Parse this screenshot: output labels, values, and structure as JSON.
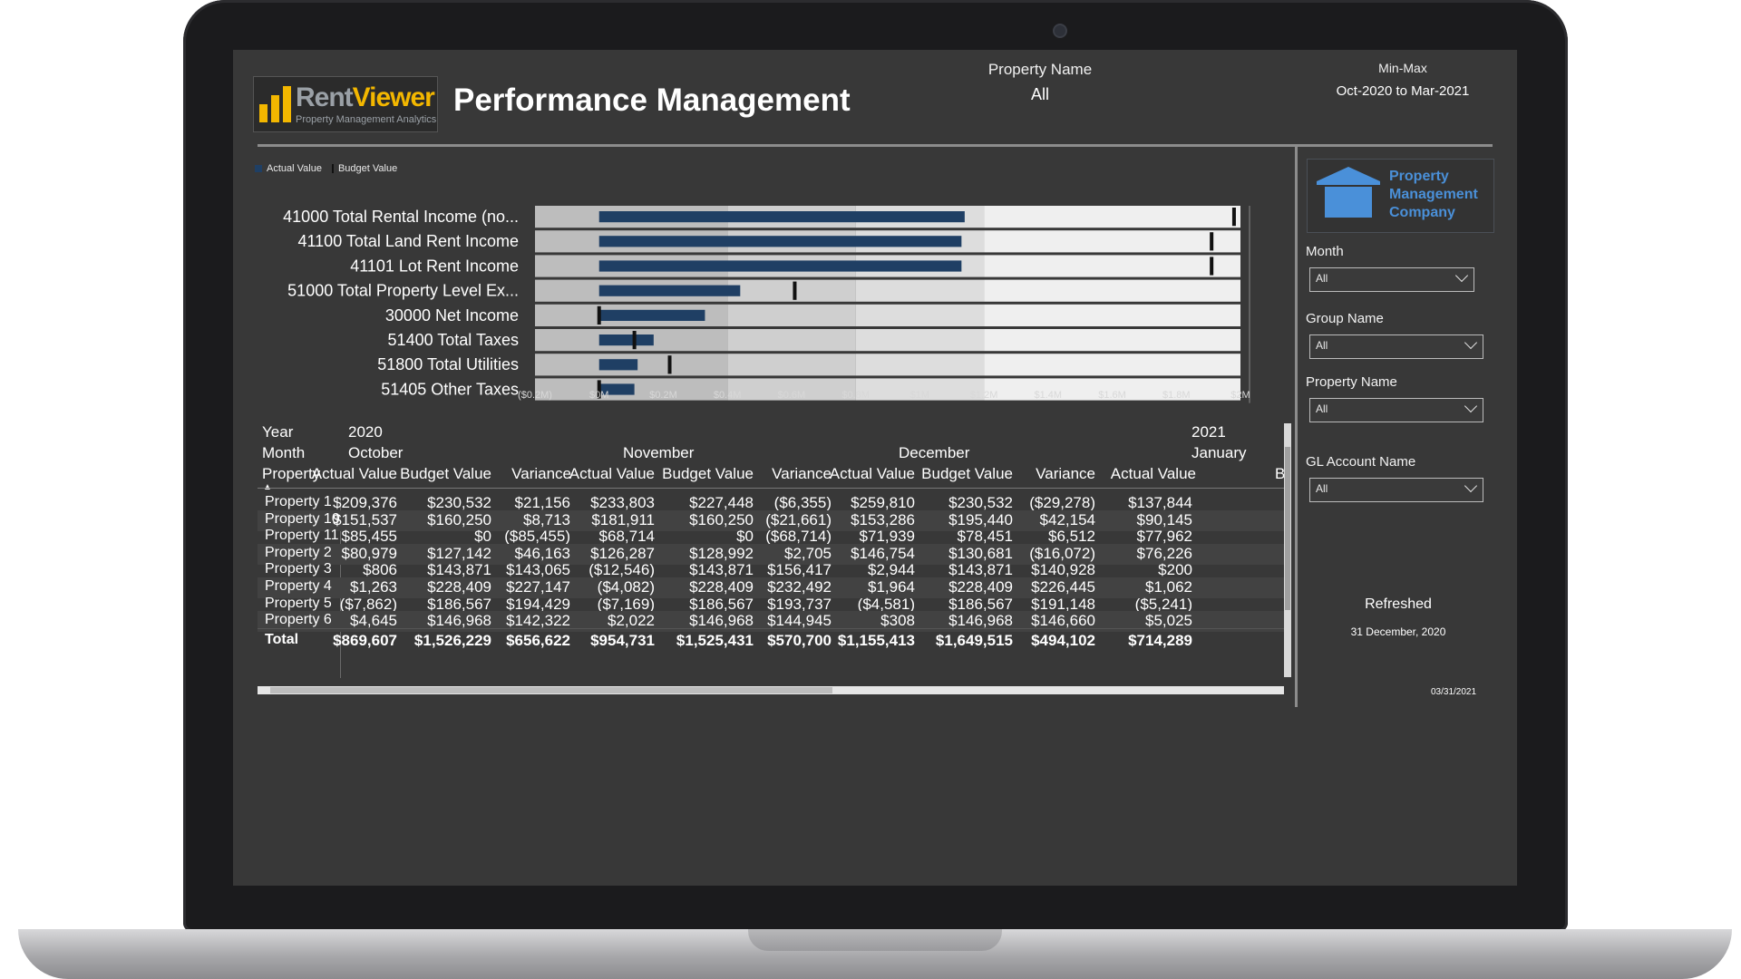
{
  "header": {
    "logo_word1": "Rent",
    "logo_word2": "Viewer",
    "logo_tagline": "Property Management Analytics",
    "title": "Performance Management",
    "property_label": "Property Name",
    "property_value": "All",
    "minmax_label": "Min-Max",
    "minmax_value": "Oct-2020 to Mar-2021"
  },
  "legend": {
    "actual": "Actual Value",
    "budget": "Budget Value"
  },
  "chart_data": {
    "type": "bar",
    "orientation": "horizontal",
    "subtype": "bullet",
    "categories": [
      "41000 Total Rental Income (no...",
      "41100 Total Land Rent Income",
      "41101 Lot Rent Income",
      "51000 Total Property Level Ex...",
      "30000 Net Income",
      "51400 Total Taxes",
      "51800 Total Utilities",
      "51405 Other Taxes"
    ],
    "series": [
      {
        "name": "Actual Value",
        "values": [
          1.14,
          1.13,
          1.13,
          0.44,
          0.33,
          0.17,
          0.12,
          0.11
        ]
      },
      {
        "name": "Budget Value",
        "values": [
          1.98,
          1.91,
          1.91,
          0.61,
          0.0,
          0.11,
          0.22,
          0.0
        ]
      }
    ],
    "xlim": [
      -0.2,
      2.0
    ],
    "xticks": [
      "($0.2M)",
      "$0M",
      "$0.2M",
      "$0.4M",
      "$0.6M",
      "$0.8M",
      "$1M",
      "$1.2M",
      "$1.4M",
      "$1.6M",
      "$1.8M",
      "$2M"
    ],
    "bands": [
      0.4,
      0.8,
      1.2,
      2.0
    ],
    "band_colors": [
      "#bdbdbd",
      "#cfcfcf",
      "#dddddd",
      "#efefef"
    ],
    "actual_color": "#1f3f64",
    "budget_color": "#111111"
  },
  "matrix": {
    "row_headers": [
      "Year",
      "Month",
      "Property"
    ],
    "years": [
      "2020",
      "2021"
    ],
    "months": [
      "October",
      "November",
      "December",
      "January"
    ],
    "columns": [
      "Actual Value",
      "Budget Value",
      "Variance",
      "Actual Value",
      "Budget Value",
      "Variance",
      "Actual Value",
      "Budget Value",
      "Variance",
      "Actual Value",
      "B"
    ],
    "rows": [
      {
        "name": "Property 1",
        "vals": [
          "$209,376",
          "$230,532",
          "$21,156",
          "$233,803",
          "$227,448",
          "($6,355)",
          "$259,810",
          "$230,532",
          "($29,278)",
          "$137,844"
        ]
      },
      {
        "name": "Property 10",
        "vals": [
          "$151,537",
          "$160,250",
          "$8,713",
          "$181,911",
          "$160,250",
          "($21,661)",
          "$153,286",
          "$195,440",
          "$42,154",
          "$90,145"
        ]
      },
      {
        "name": "Property 11",
        "vals": [
          "$85,455",
          "$0",
          "($85,455)",
          "$68,714",
          "$0",
          "($68,714)",
          "$71,939",
          "$78,451",
          "$6,512",
          "$77,962"
        ]
      },
      {
        "name": "Property 2",
        "vals": [
          "$80,979",
          "$127,142",
          "$46,163",
          "$126,287",
          "$128,992",
          "$2,705",
          "$146,754",
          "$130,681",
          "($16,072)",
          "$76,226"
        ]
      },
      {
        "name": "Property 3",
        "vals": [
          "$806",
          "$143,871",
          "$143,065",
          "($12,546)",
          "$143,871",
          "$156,417",
          "$2,944",
          "$143,871",
          "$140,928",
          "$200"
        ]
      },
      {
        "name": "Property 4",
        "vals": [
          "$1,263",
          "$228,409",
          "$227,147",
          "($4,082)",
          "$228,409",
          "$232,492",
          "$1,964",
          "$228,409",
          "$226,445",
          "$1,062"
        ]
      },
      {
        "name": "Property 5",
        "vals": [
          "($7,862)",
          "$186,567",
          "$194,429",
          "($7,169)",
          "$186,567",
          "$193,737",
          "($4,581)",
          "$186,567",
          "$191,148",
          "($5,241)"
        ]
      },
      {
        "name": "Property 6",
        "vals": [
          "$4,645",
          "$146,968",
          "$142,322",
          "$2,022",
          "$146,968",
          "$144,945",
          "$308",
          "$146,968",
          "$146,660",
          "$5,025"
        ]
      }
    ],
    "total": {
      "name": "Total",
      "vals": [
        "$869,607",
        "$1,526,229",
        "$656,622",
        "$954,731",
        "$1,525,431",
        "$570,700",
        "$1,155,413",
        "$1,649,515",
        "$494,102",
        "$714,289"
      ]
    }
  },
  "slicers": {
    "company_logo": "Property Management Company",
    "month_label": "Month",
    "month_value": "All",
    "group_label": "Group Name",
    "group_value": "All",
    "property_label": "Property Name",
    "property_value": "All",
    "gl_label": "GL Account Name",
    "gl_value": "All"
  },
  "footer": {
    "refreshed_label": "Refreshed",
    "refreshed_date": "31 December, 2020",
    "corner_date": "03/31/2021"
  }
}
